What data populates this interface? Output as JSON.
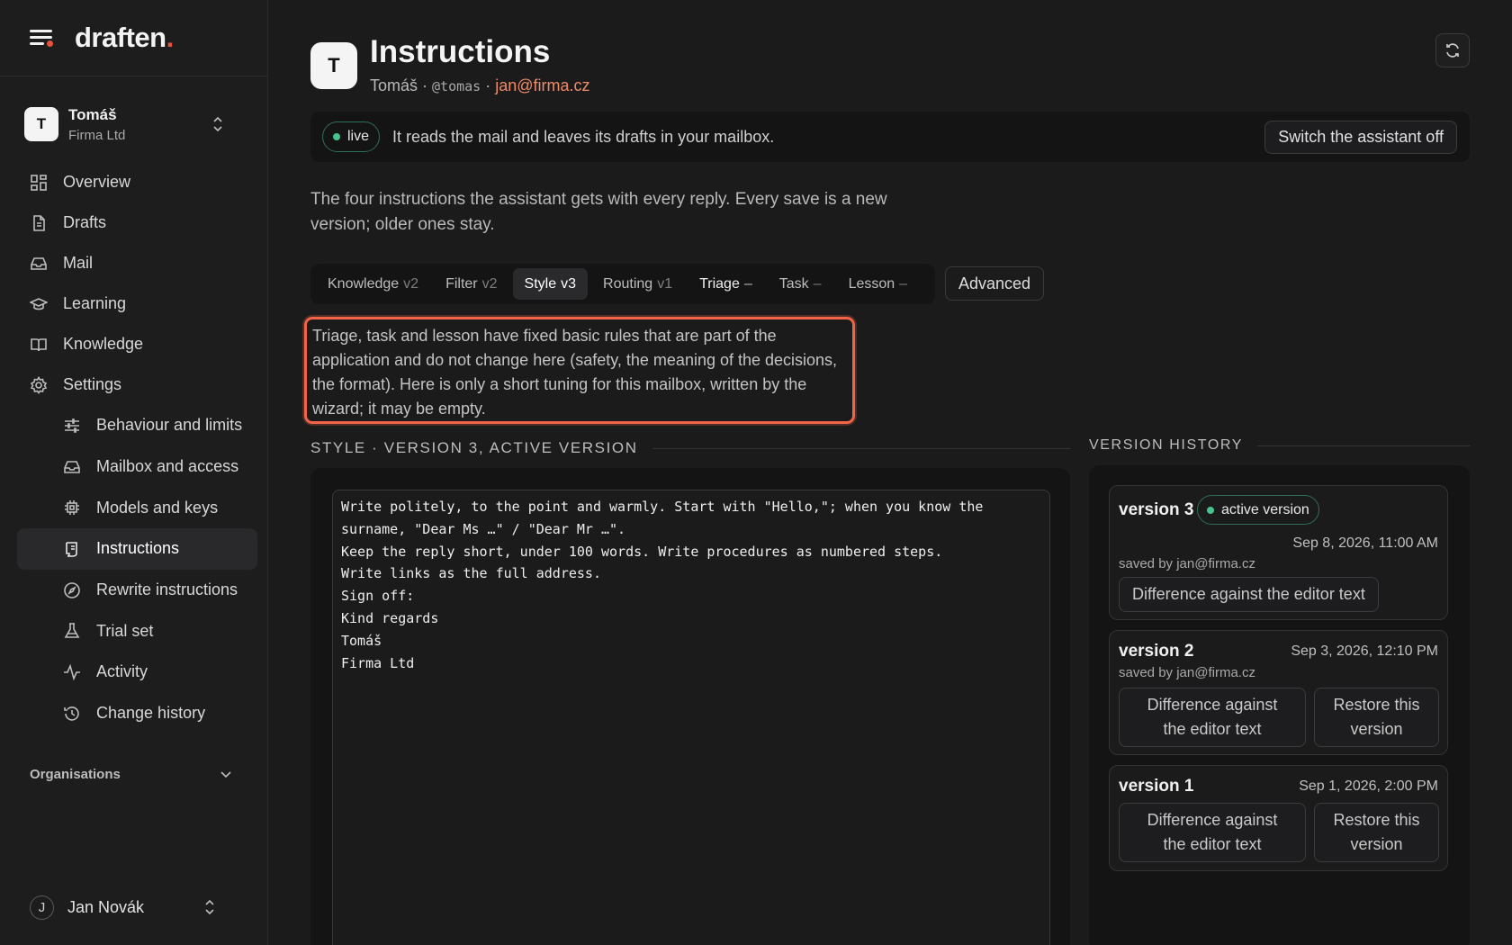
{
  "brand": {
    "name": "draften",
    "dot": "."
  },
  "account": {
    "initial": "T",
    "name": "Tomáš",
    "org": "Firma Ltd"
  },
  "nav": {
    "overview": "Overview",
    "drafts": "Drafts",
    "mail": "Mail",
    "learning": "Learning",
    "knowledge": "Knowledge",
    "settings": "Settings",
    "behaviour": "Behaviour and limits",
    "mailbox": "Mailbox and access",
    "models": "Models and keys",
    "instructions": "Instructions",
    "rewrite": "Rewrite instructions",
    "trial": "Trial set",
    "activity": "Activity",
    "change_history": "Change history"
  },
  "orgs_label": "Organisations",
  "user": {
    "initial": "J",
    "name": "Jan Novák"
  },
  "page": {
    "initial": "T",
    "title": "Instructions",
    "name": "Tomáš",
    "sep": " · ",
    "handle": "@tomas",
    "email": "jan@firma.cz"
  },
  "status": {
    "pill": "live",
    "text": "It reads the mail and leaves its drafts in your mailbox.",
    "switch_label": "Switch the assistant off"
  },
  "intro": "The four instructions the assistant gets with every reply. Every save is a new version; older ones stay.",
  "tabs": [
    {
      "label": "Knowledge",
      "ver": "v2"
    },
    {
      "label": "Filter",
      "ver": "v2"
    },
    {
      "label": "Style",
      "ver": "v3"
    },
    {
      "label": "Routing",
      "ver": "v1"
    },
    {
      "label": "Triage",
      "ver": "–"
    },
    {
      "label": "Task",
      "ver": "–"
    },
    {
      "label": "Lesson",
      "ver": "–"
    }
  ],
  "advanced_label": "Advanced",
  "note": "Triage, task and lesson have fixed basic rules that are part of the application and do not change here (safety, the meaning of the decisions, the format). Here is only a short tuning for this mailbox, written by the wizard; it may be empty.",
  "section_title": "STYLE · VERSION 3, ACTIVE VERSION",
  "editor_text": "Write politely, to the point and warmly. Start with \"Hello,\"; when you know the\nsurname, \"Dear Ms …\" / \"Dear Mr …\".\nKeep the reply short, under 100 words. Write procedures as numbered steps.\nWrite links as the full address.\nSign off:\nKind regards\nTomáš\nFirma Ltd",
  "history": {
    "title": "VERSION HISTORY",
    "versions": [
      {
        "title": "version 3",
        "badge": "active version",
        "date": "Sep 8, 2026, 11:00 AM",
        "saved_by": "saved by jan@firma.cz",
        "diff": "Difference against the editor text"
      },
      {
        "title": "version 2",
        "date": "Sep 3, 2026, 12:10 PM",
        "saved_by": "saved by jan@firma.cz",
        "diff": "Difference against the editor text",
        "restore": "Restore this version"
      },
      {
        "title": "version 1",
        "date": "Sep 1, 2026, 2:00 PM",
        "diff": "Difference against the editor text",
        "restore": "Restore this version"
      }
    ]
  },
  "colors": {
    "accent": "#e5533d",
    "live": "#48c28b",
    "highlight_border": "#f16448",
    "email": "#ef8a6a"
  }
}
